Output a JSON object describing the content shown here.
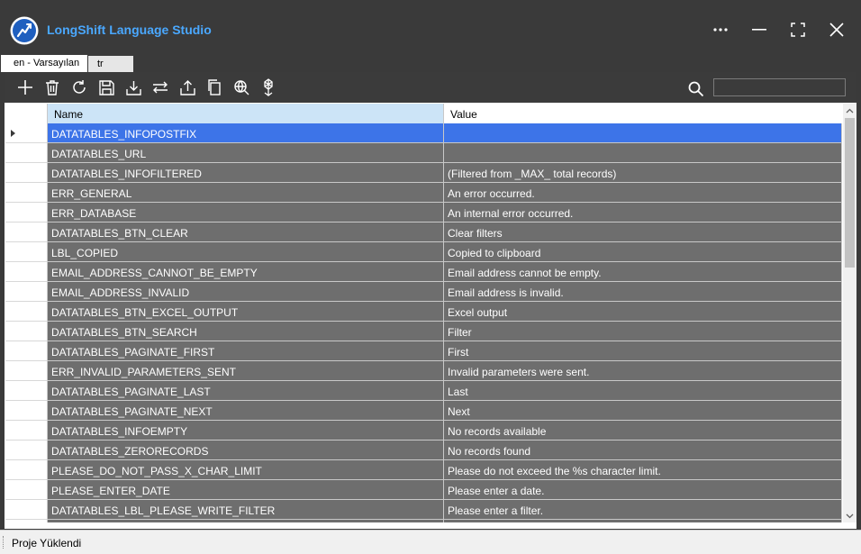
{
  "app": {
    "title": "LongShift Language Studio"
  },
  "window_controls": {
    "more_icon": "more-horizontal-icon",
    "minimize_icon": "minimize-icon",
    "maximize_icon": "maximize-icon",
    "close_icon": "close-icon"
  },
  "tabs": [
    {
      "label": "en - Varsayılan",
      "active": true
    },
    {
      "label": "tr",
      "active": false
    }
  ],
  "toolbar": {
    "buttons": [
      "add-icon",
      "delete-icon",
      "refresh-icon",
      "save-icon",
      "import-icon",
      "compare-icon",
      "export-icon",
      "copy-icon",
      "translate-icon",
      "deploy-icon"
    ],
    "search_icon": "search-icon",
    "search_value": ""
  },
  "grid": {
    "columns": {
      "name": "Name",
      "value": "Value"
    },
    "selected_index": 0,
    "rows": [
      {
        "name": "DATATABLES_INFOPOSTFIX",
        "value": ""
      },
      {
        "name": "DATATABLES_URL",
        "value": ""
      },
      {
        "name": "DATATABLES_INFOFILTERED",
        "value": "(Filtered from _MAX_ total records)"
      },
      {
        "name": "ERR_GENERAL",
        "value": "An error occurred."
      },
      {
        "name": "ERR_DATABASE",
        "value": "An internal error occurred."
      },
      {
        "name": "DATATABLES_BTN_CLEAR",
        "value": "Clear filters"
      },
      {
        "name": "LBL_COPIED",
        "value": "Copied to clipboard"
      },
      {
        "name": "EMAIL_ADDRESS_CANNOT_BE_EMPTY",
        "value": "Email address cannot be empty."
      },
      {
        "name": "EMAIL_ADDRESS_INVALID",
        "value": "Email address is invalid."
      },
      {
        "name": "DATATABLES_BTN_EXCEL_OUTPUT",
        "value": "Excel output"
      },
      {
        "name": "DATATABLES_BTN_SEARCH",
        "value": "Filter"
      },
      {
        "name": "DATATABLES_PAGINATE_FIRST",
        "value": "First"
      },
      {
        "name": "ERR_INVALID_PARAMETERS_SENT",
        "value": "Invalid parameters were sent."
      },
      {
        "name": "DATATABLES_PAGINATE_LAST",
        "value": "Last"
      },
      {
        "name": "DATATABLES_PAGINATE_NEXT",
        "value": "Next"
      },
      {
        "name": "DATATABLES_INFOEMPTY",
        "value": "No records available"
      },
      {
        "name": "DATATABLES_ZERORECORDS",
        "value": "No records found"
      },
      {
        "name": "PLEASE_DO_NOT_PASS_X_CHAR_LIMIT",
        "value": "Please do not exceed the %s character limit."
      },
      {
        "name": "PLEASE_ENTER_DATE",
        "value": "Please enter a date."
      },
      {
        "name": "DATATABLES_LBL_PLEASE_WRITE_FILTER",
        "value": "Please enter a filter."
      },
      {
        "name": "",
        "value": ""
      }
    ]
  },
  "status": {
    "text": "Proje Yüklendi"
  },
  "colors": {
    "accent": "#4aa8ff",
    "selection": "#3d74e8",
    "cell_bg": "#6e6e6e",
    "header_selected": "#cce4f7"
  }
}
